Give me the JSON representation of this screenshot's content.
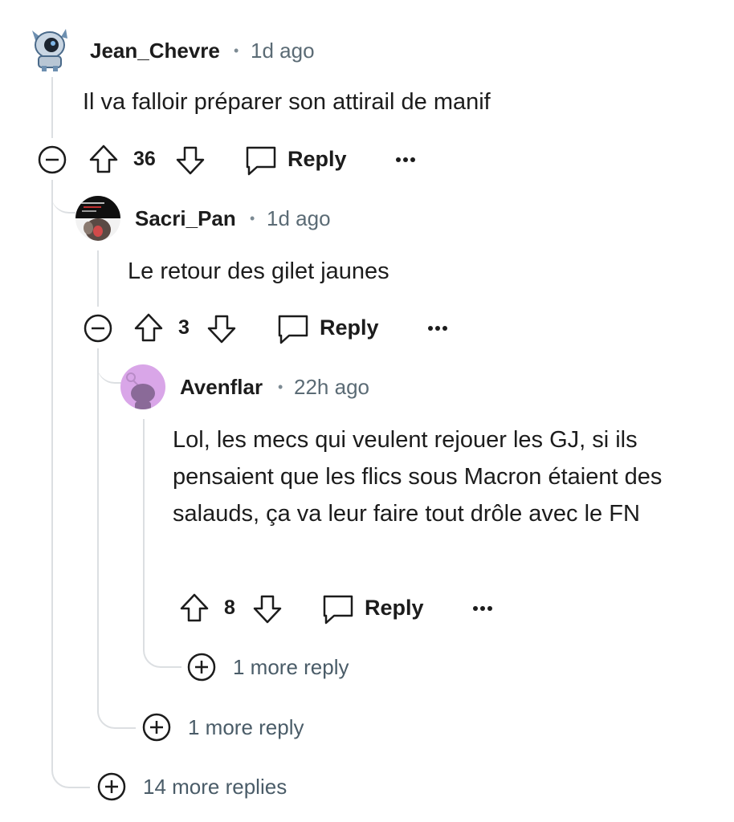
{
  "comments": [
    {
      "username": "Jean_Chevre",
      "separator": "•",
      "time": "1d ago",
      "text": "Il va falloir préparer son attirail de manif",
      "votes": "36",
      "reply_label": "Reply",
      "avatar": "robot-avatar-icon"
    },
    {
      "username": "Sacri_Pan",
      "separator": "•",
      "time": "1d ago",
      "text": "Le retour des gilet jaunes",
      "votes": "3",
      "reply_label": "Reply",
      "avatar": "dark-photo-avatar"
    },
    {
      "username": "Avenflar",
      "separator": "•",
      "time": "22h ago",
      "text": "Lol, les mecs qui veulent rejouer les GJ, si ils pensaient que les flics sous Macron étaient des salauds, ça va leur faire tout drôle avec le FN",
      "votes": "8",
      "reply_label": "Reply",
      "avatar": "snoo-avatar-icon"
    }
  ],
  "more_replies": {
    "level3": "1 more reply",
    "level2": "1 more reply",
    "level1": "14 more replies"
  },
  "colors": {
    "text": "#1c1c1c",
    "muted": "#5b6b75",
    "thread_line": "#dcdfe2",
    "snoo_bg": "#d9a6e8"
  }
}
